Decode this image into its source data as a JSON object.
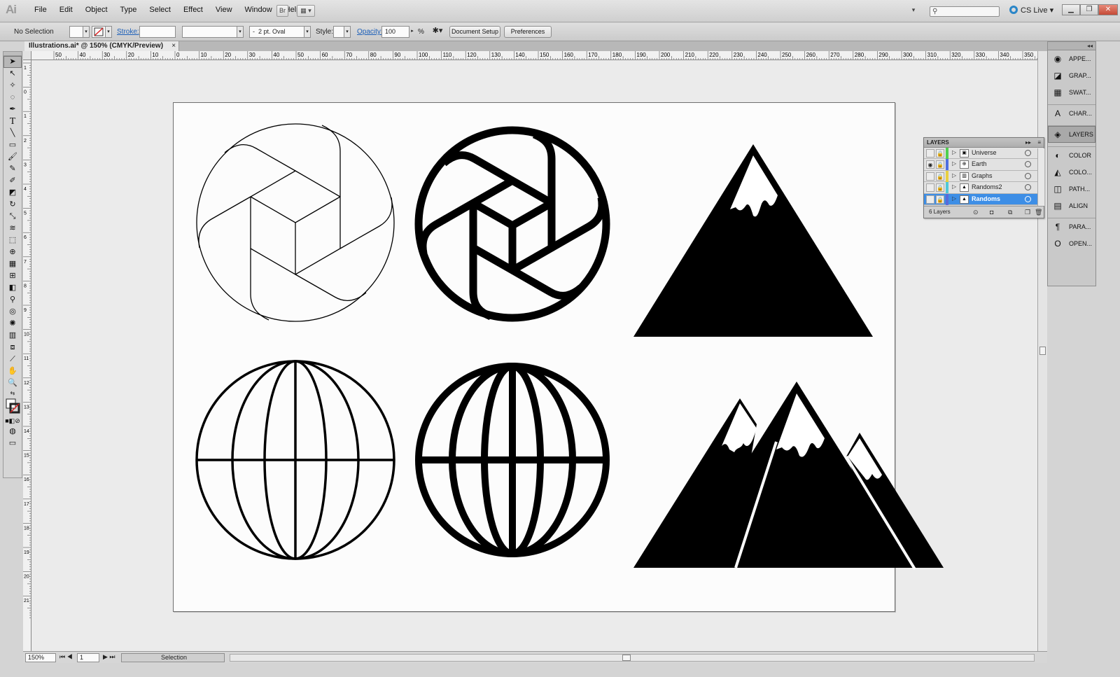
{
  "app": {
    "logo": "Ai",
    "menus": [
      "File",
      "Edit",
      "Object",
      "Type",
      "Select",
      "Effect",
      "View",
      "Window",
      "Help"
    ],
    "bridge_label": "Br",
    "cs_live": "CS Live ▾"
  },
  "control": {
    "selection_state": "No Selection",
    "stroke_label": "Stroke:",
    "brush_value": "2 pt. Oval",
    "brush_bullet": "-",
    "style_label": "Style:",
    "opacity_label": "Opacity:",
    "opacity_value": "100",
    "opacity_unit": "%",
    "document_setup": "Document Setup",
    "preferences": "Preferences"
  },
  "document": {
    "tab_title": "Illustrations.ai* @ 150% (CMYK/Preview)",
    "close": "×"
  },
  "rulers": {
    "h_labels": [
      "50",
      "40",
      "30",
      "20",
      "10",
      "0",
      "10",
      "20",
      "30",
      "40",
      "50",
      "60",
      "70",
      "80",
      "90",
      "100",
      "110",
      "120",
      "130",
      "140",
      "150",
      "160",
      "170",
      "180",
      "190",
      "200",
      "210",
      "220",
      "230",
      "240",
      "250",
      "260",
      "270",
      "280",
      "290",
      "300",
      "310",
      "320",
      "330",
      "340",
      "350"
    ],
    "v_labels": [
      "1",
      "0",
      "1",
      "2",
      "3",
      "4",
      "5",
      "6",
      "7",
      "8",
      "9",
      "10",
      "11",
      "12",
      "13",
      "14",
      "15",
      "16",
      "17",
      "18",
      "19",
      "20",
      "21"
    ]
  },
  "status": {
    "zoom": "150%",
    "artboard": "1",
    "tool_readout": "Selection"
  },
  "dock": {
    "items": [
      {
        "label": "APPE...",
        "icon": "appearance-icon"
      },
      {
        "label": "GRAP...",
        "icon": "graphic-styles-icon"
      },
      {
        "label": "SWAT...",
        "icon": "swatches-icon"
      },
      {
        "label": "CHAR...",
        "icon": "character-icon"
      },
      {
        "label": "LAYERS",
        "icon": "layers-icon"
      },
      {
        "label": "COLOR",
        "icon": "color-icon"
      },
      {
        "label": "COLO...",
        "icon": "color-guide-icon"
      },
      {
        "label": "PATH...",
        "icon": "pathfinder-icon"
      },
      {
        "label": "ALIGN",
        "icon": "align-icon"
      },
      {
        "label": "PARA...",
        "icon": "paragraph-icon"
      },
      {
        "label": "OPEN...",
        "icon": "opentype-icon"
      }
    ]
  },
  "layers_panel": {
    "title": "LAYERS",
    "count": "6 Layers",
    "layers": [
      {
        "name": "Universe",
        "color": "#4fd04f",
        "visible": false,
        "selected": false
      },
      {
        "name": "Earth",
        "color": "#4f6fe0",
        "visible": true,
        "selected": false
      },
      {
        "name": "Graphs",
        "color": "#e8d040",
        "visible": false,
        "selected": false
      },
      {
        "name": "Randoms2",
        "color": "#50c8d8",
        "visible": false,
        "selected": false
      },
      {
        "name": "Randoms",
        "color": "#5a6ad8",
        "visible": false,
        "selected": true
      }
    ]
  }
}
